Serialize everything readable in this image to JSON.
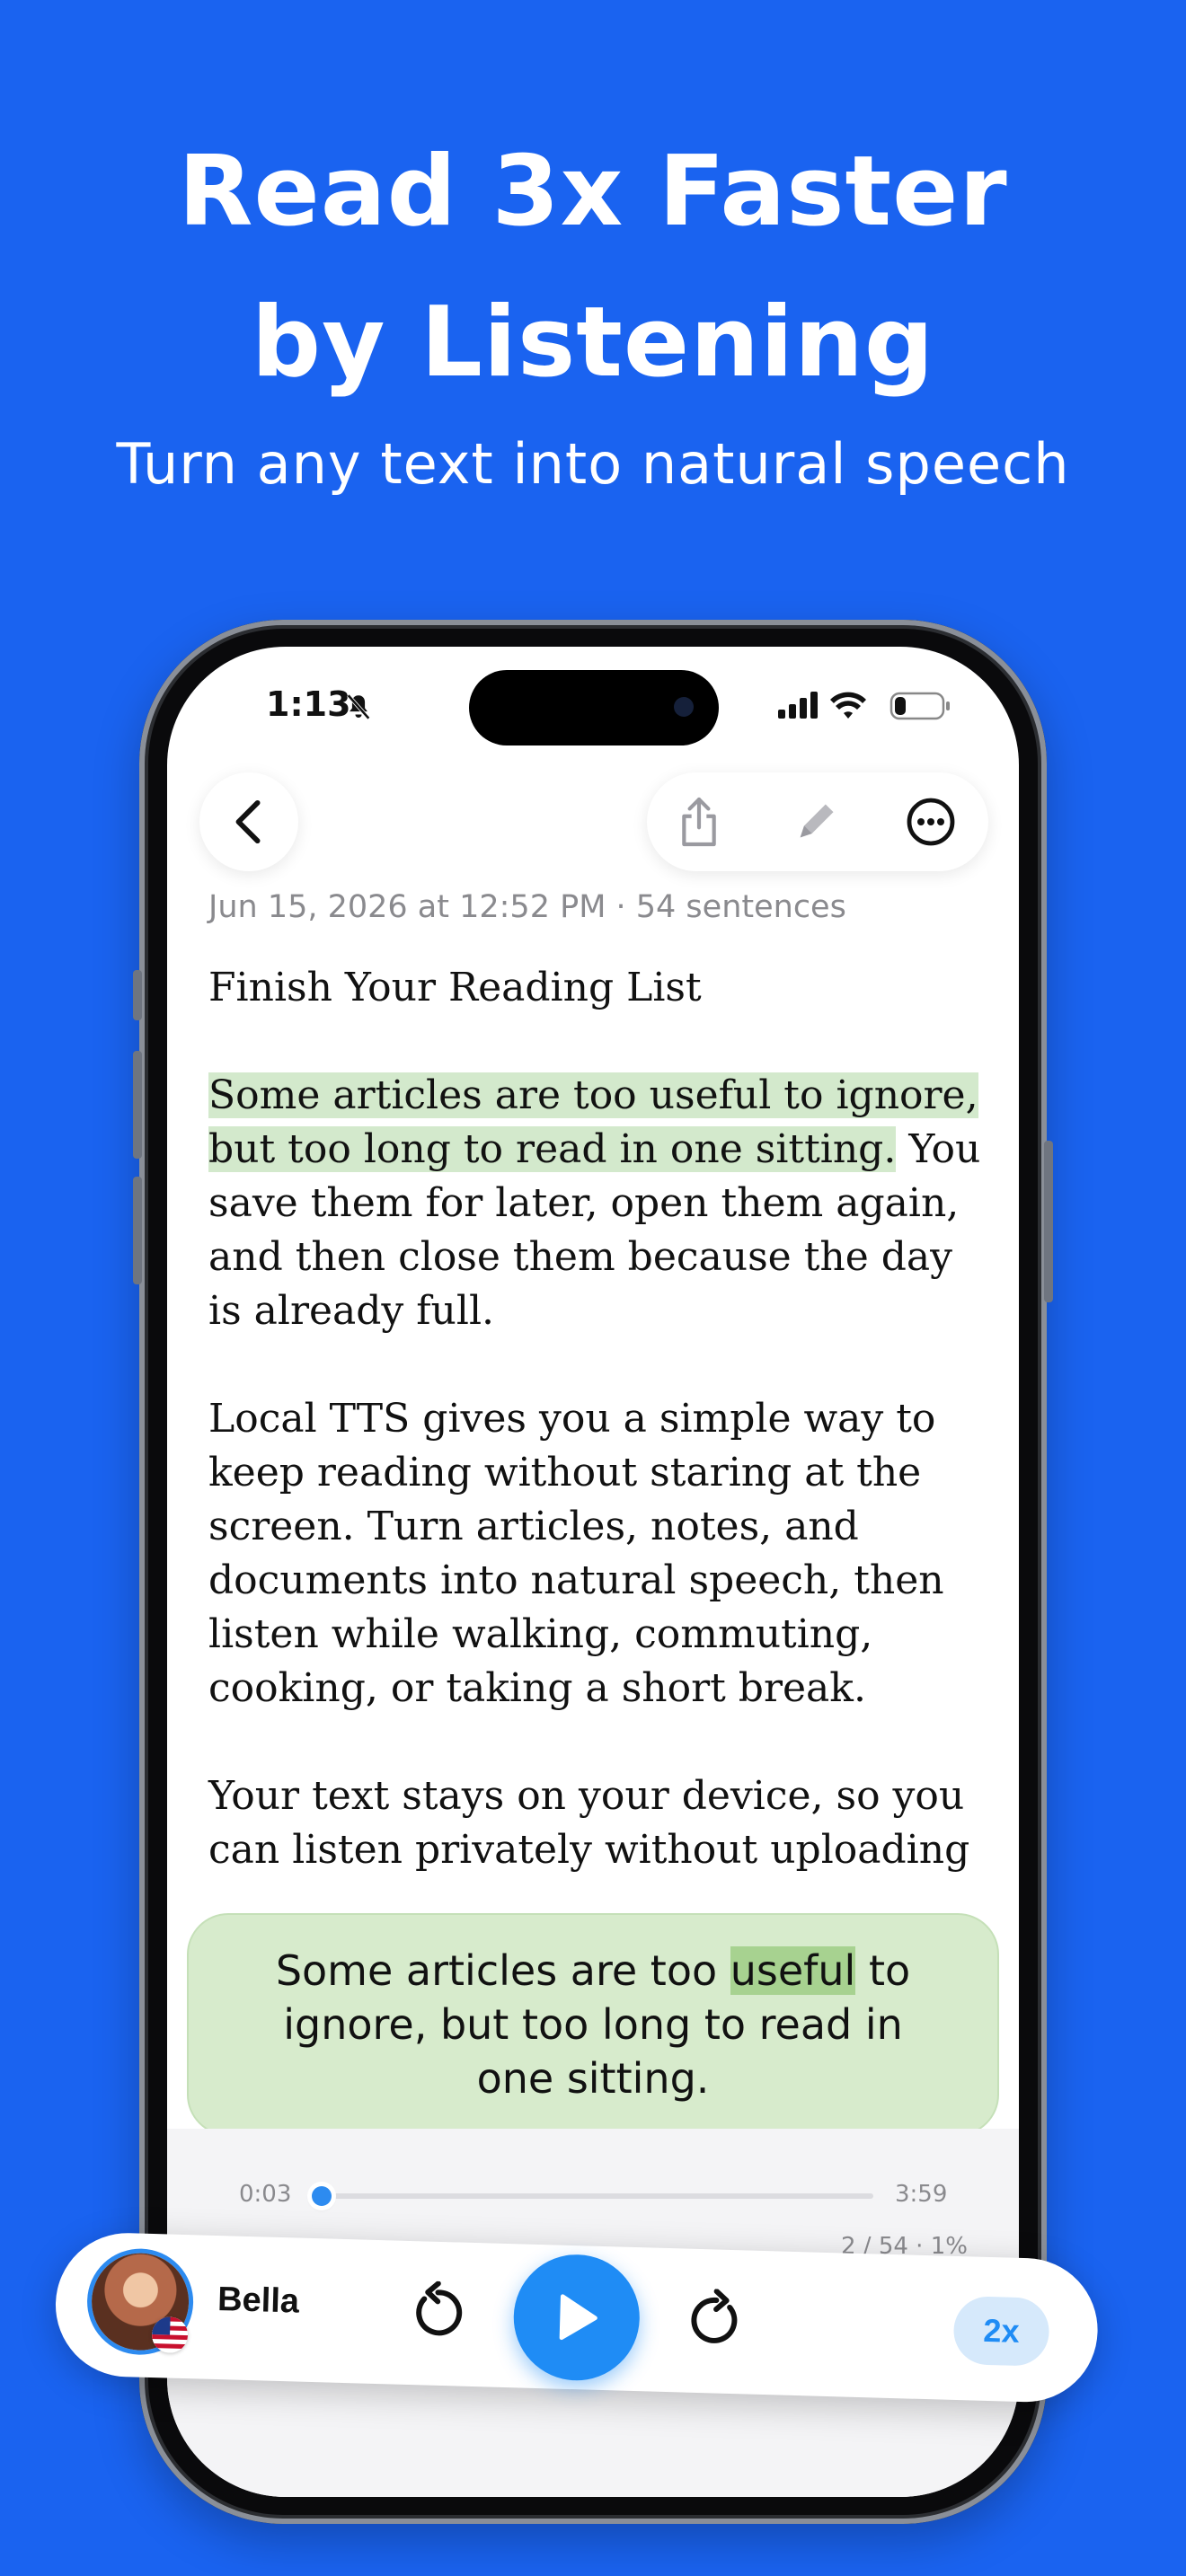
{
  "promo": {
    "title_line1": "Read 3x Faster",
    "title_line2": "by Listening",
    "subtitle": "Turn any text into natural speech"
  },
  "status_bar": {
    "time": "1:13"
  },
  "toolbar": {
    "icons": [
      "back-chevron-icon",
      "share-icon",
      "pencil-icon",
      "more-icon"
    ]
  },
  "document": {
    "meta": "Jun 15, 2026 at 12:52 PM · 54 sentences",
    "title": "Finish Your Reading List",
    "p1_highlighted": "Some articles are too useful to ignore, but too long to read in one sitting.",
    "p1_rest": " You save them for later, open them again, and then close them because the day is already full.",
    "p2": "Local TTS gives you a simple way to keep reading without staring at the screen. Turn articles, notes, and documents into natural speech, then listen while walking, commuting, cooking, or taking a short break.",
    "p3": "Your text stays on your device, so you can listen privately without uploading"
  },
  "caption": {
    "before": "Some articles are too ",
    "current_word": "useful",
    "after": " to ignore, but too long to read in one sitting."
  },
  "player": {
    "elapsed": "0:03",
    "duration": "3:59",
    "progress_fraction": 0.01,
    "progress_text": "2 / 54 · 1%",
    "voice_name": "Bella",
    "speed": "2x",
    "accent_color": "#1f8cf5",
    "highlight_color": "#d3e9cc"
  },
  "colors": {
    "background": "#1a63f0"
  }
}
